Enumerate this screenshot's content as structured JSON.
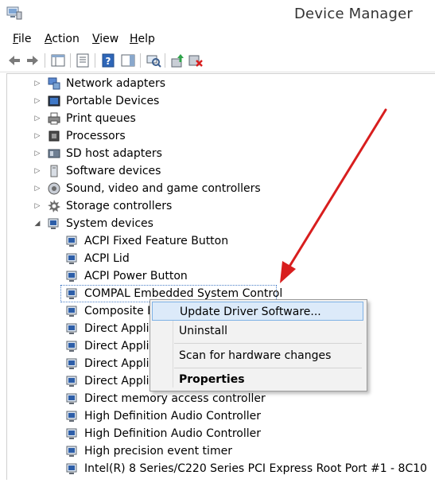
{
  "window": {
    "title": "Device Manager"
  },
  "menu": [
    "File",
    "Action",
    "View",
    "Help"
  ],
  "menu_underline": [
    "F",
    "A",
    "V",
    "H"
  ],
  "tree": {
    "categories": [
      {
        "label": "Network adapters",
        "icon": "network-adapter-icon"
      },
      {
        "label": "Portable Devices",
        "icon": "portable-device-icon"
      },
      {
        "label": "Print queues",
        "icon": "printer-icon"
      },
      {
        "label": "Processors",
        "icon": "processor-icon"
      },
      {
        "label": "SD host adapters",
        "icon": "sd-host-icon"
      },
      {
        "label": "Software devices",
        "icon": "software-device-icon"
      },
      {
        "label": "Sound, video and game controllers",
        "icon": "speaker-icon"
      },
      {
        "label": "Storage controllers",
        "icon": "storage-controller-icon"
      },
      {
        "label": "System devices",
        "icon": "system-devices-icon"
      }
    ],
    "system_devices": [
      "ACPI Fixed Feature Button",
      "ACPI Lid",
      "ACPI Power Button",
      "COMPAL Embedded System Control",
      "Composite B",
      "Direct Appli",
      "Direct Appli",
      "Direct Appli",
      "Direct Appli",
      "Direct memory access controller",
      "High Definition Audio Controller",
      "High Definition Audio Controller",
      "High precision event timer",
      "Intel(R) 8 Series/C220 Series PCI Express Root Port #1 - 8C10"
    ]
  },
  "context_menu": {
    "update": "Update Driver Software...",
    "uninstall": "Uninstall",
    "scan": "Scan for hardware changes",
    "properties": "Properties"
  },
  "colors": {
    "arrow": "#d81e1e",
    "selection": "#4a7fc7",
    "menu_hover": "#dceaf9"
  }
}
